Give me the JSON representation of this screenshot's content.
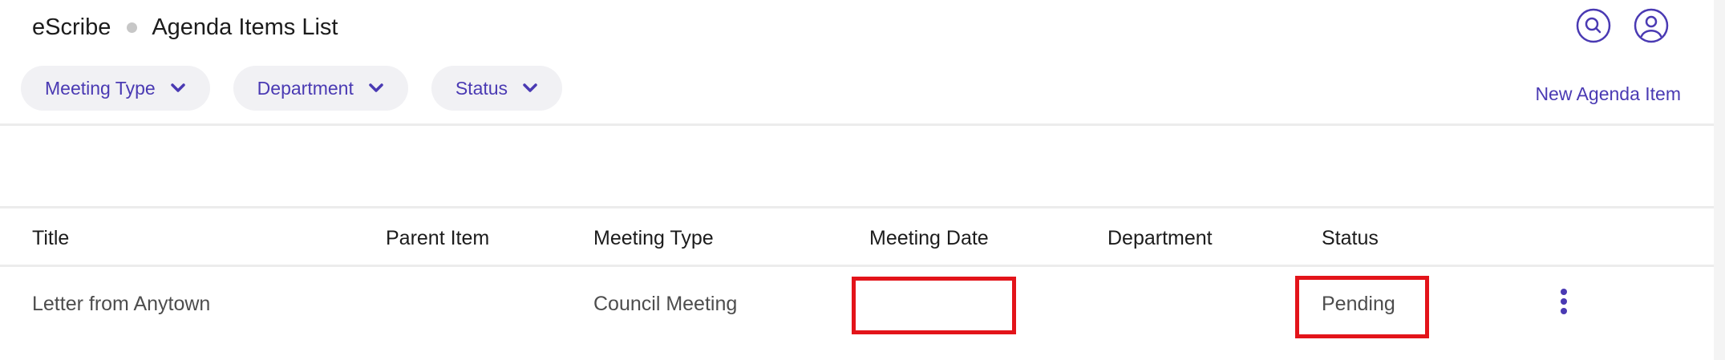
{
  "header": {
    "app_name": "eScribe",
    "page_title": "Agenda Items List"
  },
  "filters": [
    {
      "label": "Meeting Type",
      "icon": "chevron-down-icon"
    },
    {
      "label": "Department",
      "icon": "chevron-down-icon"
    },
    {
      "label": "Status",
      "icon": "chevron-down-icon"
    }
  ],
  "actions": {
    "new_item_label": "New Agenda Item",
    "search_icon": "search-icon",
    "user_icon": "user-icon"
  },
  "table": {
    "columns": [
      "Title",
      "Parent Item",
      "Meeting Type",
      "Meeting Date",
      "Department",
      "Status"
    ],
    "rows": [
      {
        "title": "Letter from Anytown",
        "parent_item": "",
        "meeting_type": "Council Meeting",
        "meeting_date": "",
        "department": "",
        "status": "Pending",
        "menu_icon": "more-vertical-icon"
      }
    ]
  },
  "colors": {
    "accent": "#4a3ab3",
    "highlight": "#e3141a",
    "pill_bg": "#f1f1f4"
  }
}
